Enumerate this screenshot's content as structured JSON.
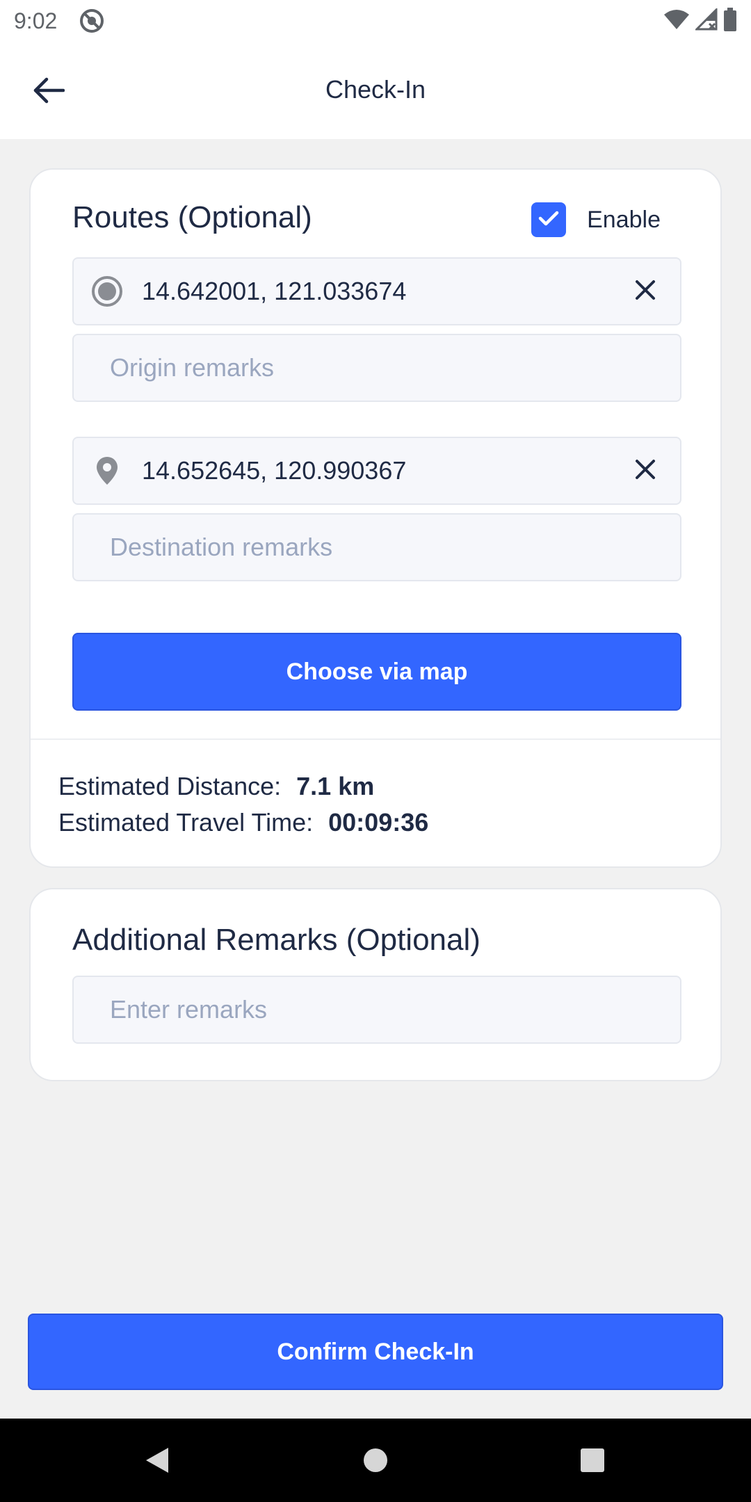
{
  "status_bar": {
    "time": "9:02",
    "icons": [
      "app-notification-icon",
      "wifi-icon",
      "signal-icon",
      "battery-icon"
    ]
  },
  "header": {
    "title": "Check-In",
    "back_icon": "arrow-left-icon"
  },
  "routes": {
    "title": "Routes (Optional)",
    "enable_label": "Enable",
    "enabled": true,
    "origin": {
      "value": "14.642001, 121.033674",
      "icon": "radio-dot-icon",
      "remarks_placeholder": "Origin remarks"
    },
    "destination": {
      "value": "14.652645, 120.990367",
      "icon": "map-pin-icon",
      "remarks_placeholder": "Destination remarks"
    },
    "choose_map_label": "Choose via map",
    "estimates": {
      "distance_label": "Estimated Distance:",
      "distance_value": "7.1 km",
      "time_label": "Estimated Travel Time:",
      "time_value": "00:09:36"
    }
  },
  "additional_remarks": {
    "title": "Additional Remarks (Optional)",
    "placeholder": "Enter remarks"
  },
  "confirm_label": "Confirm Check-In",
  "colors": {
    "primary": "#3366ff",
    "text": "#1f2a44",
    "placeholder": "#9aa6bf",
    "background": "#f1f1f1"
  }
}
